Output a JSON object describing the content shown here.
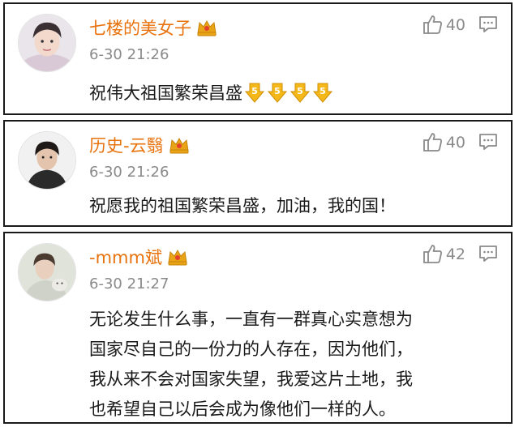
{
  "comments": [
    {
      "username": "七楼的美女子",
      "time": "6-30 21:26",
      "likes": "40",
      "text": "祝伟大祖国繁荣昌盛",
      "emoji_count": 4,
      "badge_icon": "crown-icon",
      "emoji_icon": "five-medal-icon"
    },
    {
      "username": "历史-云翳",
      "time": "6-30 21:26",
      "likes": "40",
      "text": "祝愿我的祖国繁荣昌盛，加油，我的国！",
      "badge_icon": "crown-icon"
    },
    {
      "username": "-mmm斌",
      "time": "6-30 21:27",
      "likes": "42",
      "text_lines": [
        "无论发生什么事，一直有一群真心实意想为",
        "国家尽自己的一份力的人存在，因为他们，",
        "我从来不会对国家失望，我爱这片土地，我",
        "也希望自己以后会成为像他们一样的人。"
      ],
      "badge_icon": "crown-icon"
    }
  ],
  "colors": {
    "username": "#e8720c",
    "meta": "#8a8a8a",
    "text": "#1a1a1a",
    "border": "#1a1a1a",
    "crown": "#e8a317"
  }
}
